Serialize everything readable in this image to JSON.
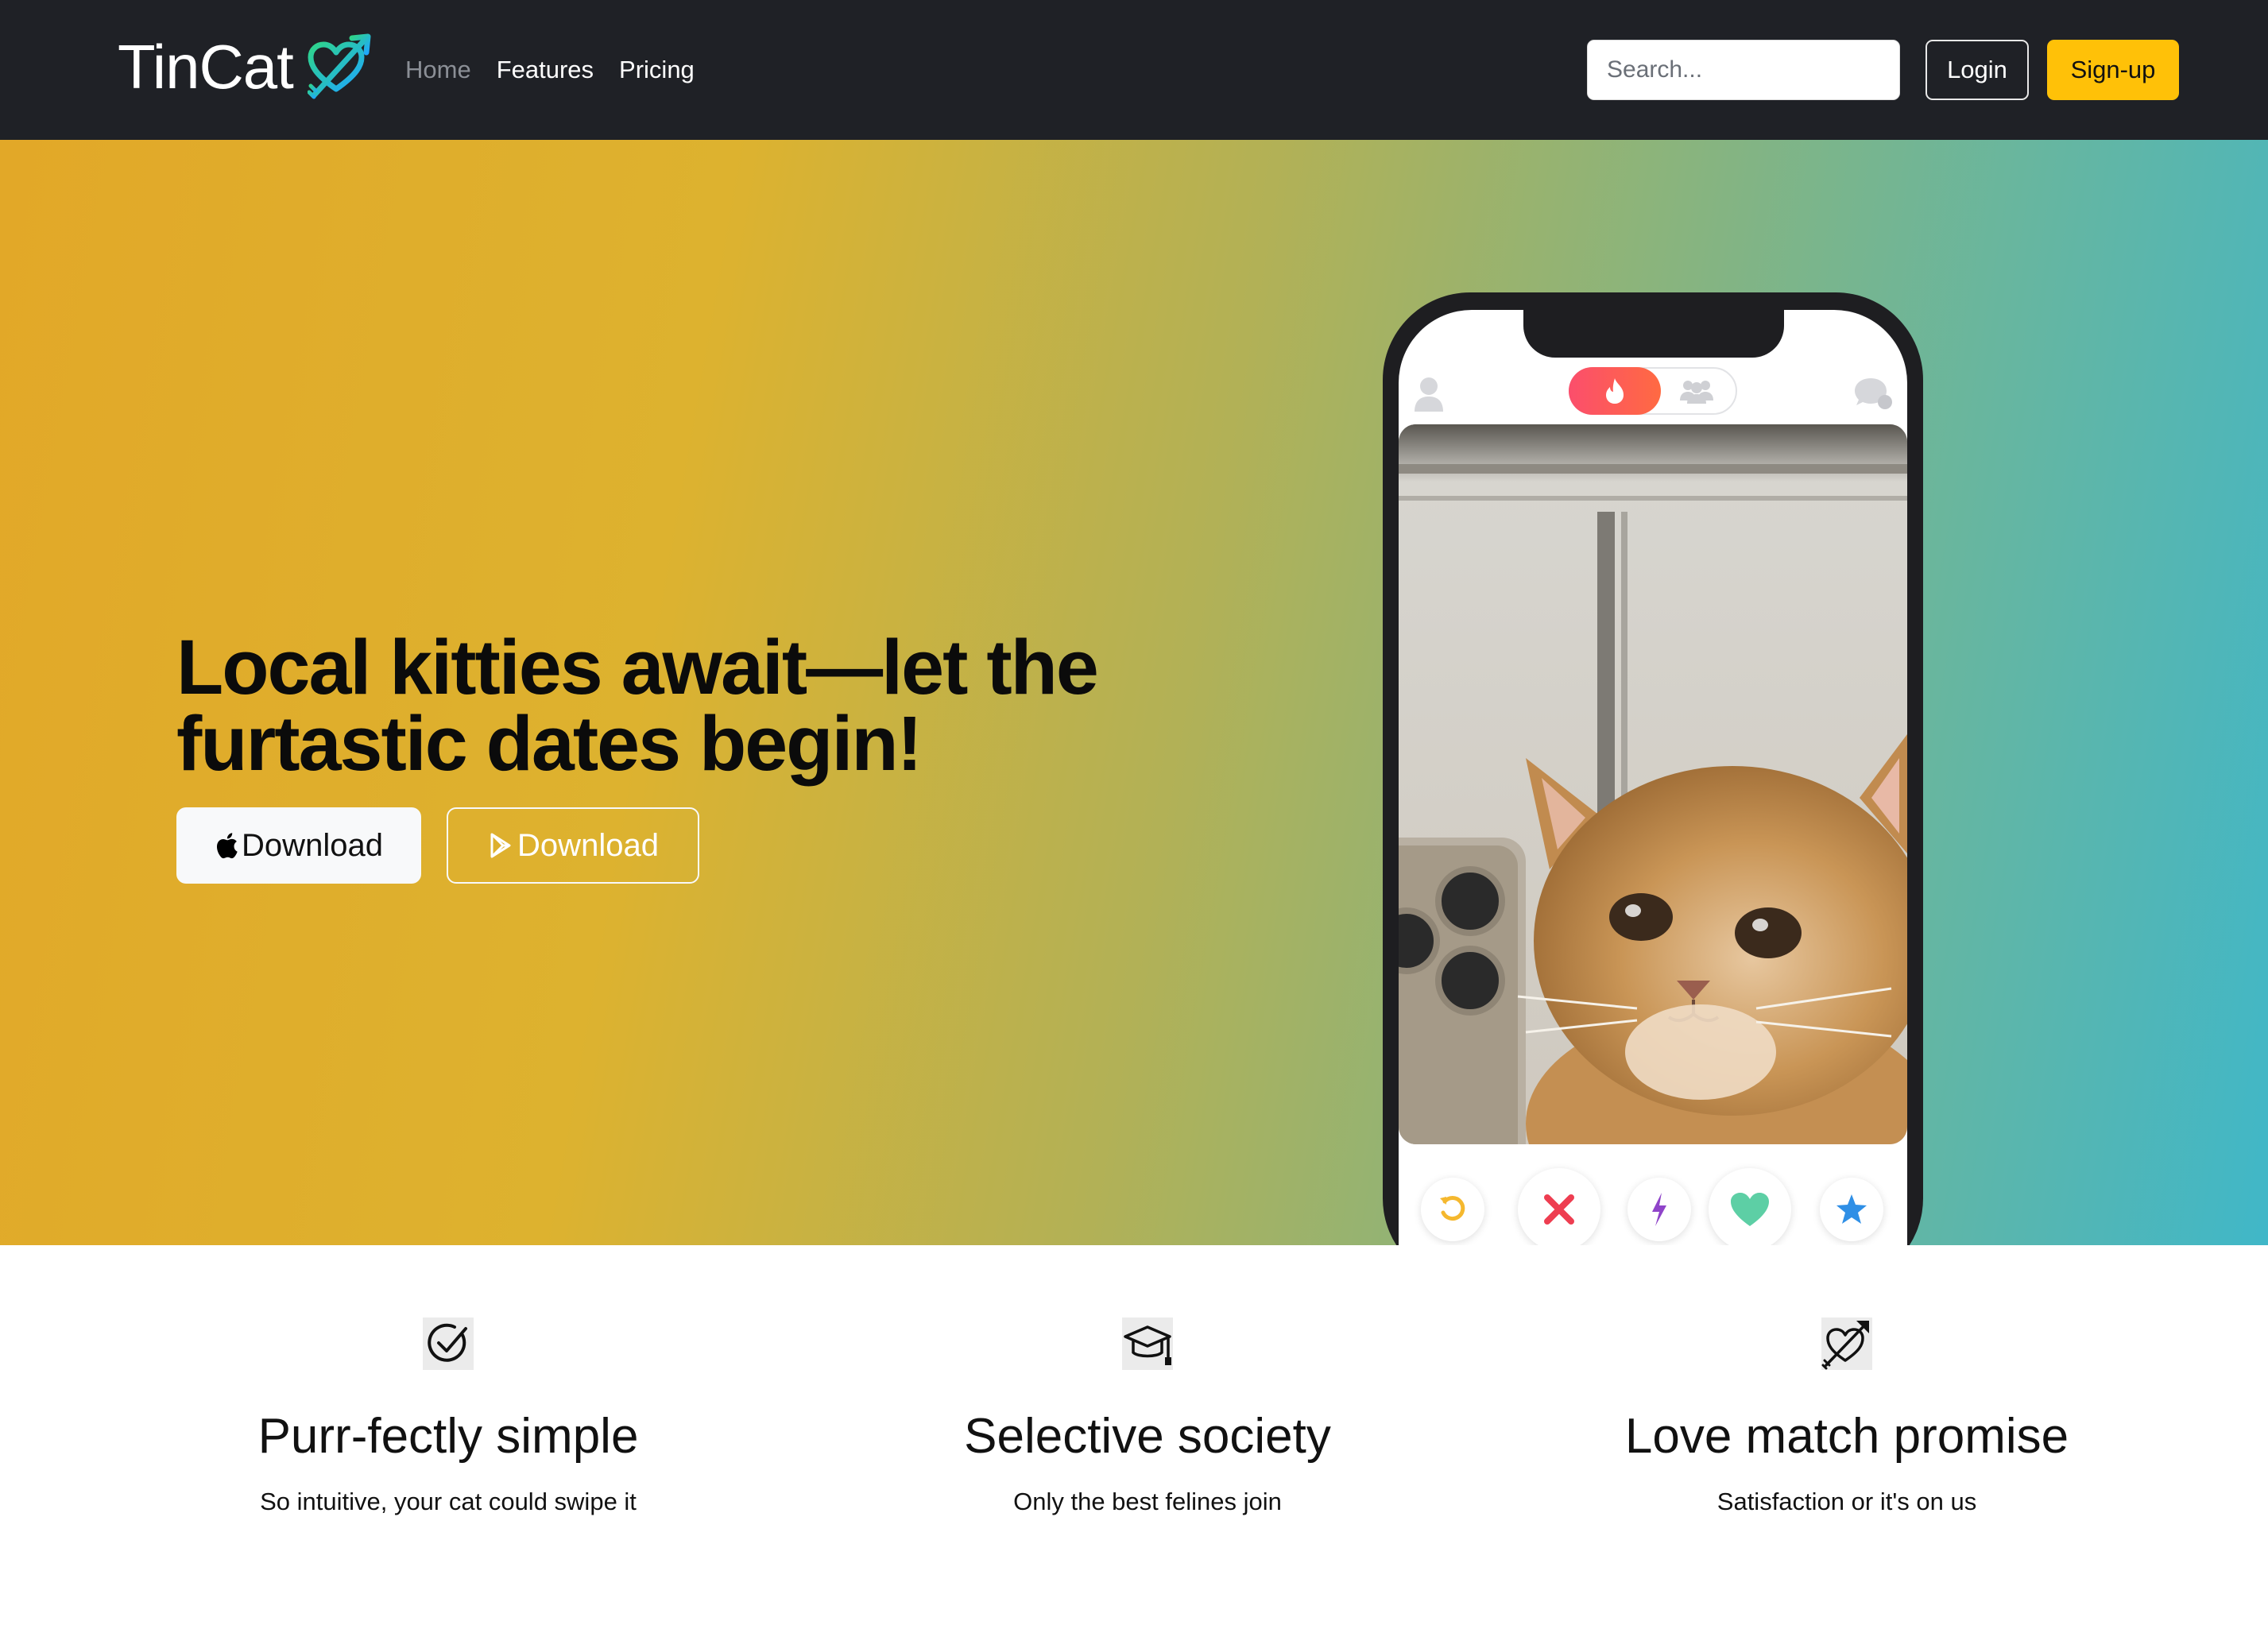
{
  "nav": {
    "brand": "TinCat",
    "links": [
      "Home",
      "Features",
      "Pricing"
    ],
    "search_placeholder": "Search...",
    "login_label": "Login",
    "signup_label": "Sign-up"
  },
  "hero": {
    "headline": "Local kitties await—let the furtastic dates begin!",
    "ios_button_label": "Download",
    "android_button_label": "Download"
  },
  "phone": {
    "toggle_items": [
      "flame-icon",
      "group-icon"
    ],
    "action_buttons": [
      "rewind-icon",
      "nope-icon",
      "boost-icon",
      "like-icon",
      "super-like-icon"
    ]
  },
  "features": [
    {
      "icon": "check-circle-icon",
      "title": "Purr-fectly simple",
      "description": "So intuitive, your cat could swipe it"
    },
    {
      "icon": "mortarboard-icon",
      "title": "Selective society",
      "description": "Only the best felines join"
    },
    {
      "icon": "heart-arrow-icon",
      "title": "Love match promise",
      "description": "Satisfaction or it's on us"
    }
  ],
  "colors": {
    "navbar": "#1f2126",
    "accent_yellow": "#ffc108",
    "hero_gradient_start": "#e2a828",
    "hero_gradient_end": "#40b7c8",
    "logo_gradient": [
      "#2fd489",
      "#1ea7ff"
    ]
  }
}
